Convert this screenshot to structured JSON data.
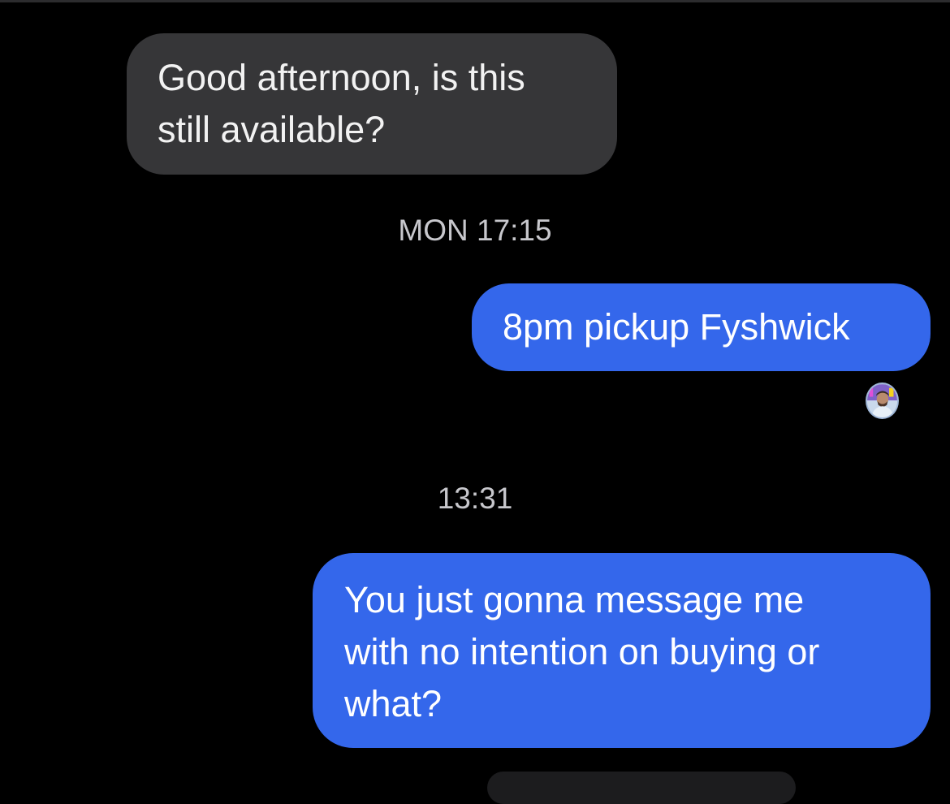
{
  "conversation": {
    "messages": [
      {
        "direction": "incoming",
        "text": "Good afternoon, is this\nstill available?"
      },
      {
        "direction": "outgoing",
        "text": "8pm pickup Fyshwick"
      },
      {
        "direction": "outgoing",
        "text": "You just gonna message me\nwith no intention on buying or\nwhat?"
      }
    ],
    "timestamps": [
      "MON 17:15",
      "13:31"
    ]
  },
  "colors": {
    "background": "#000000",
    "incoming_bubble": "#363638",
    "outgoing_bubble": "#3467eb",
    "timestamp_text": "#c7c7cc"
  },
  "icons": {
    "read_receipt": "read-receipt-avatar-icon"
  }
}
